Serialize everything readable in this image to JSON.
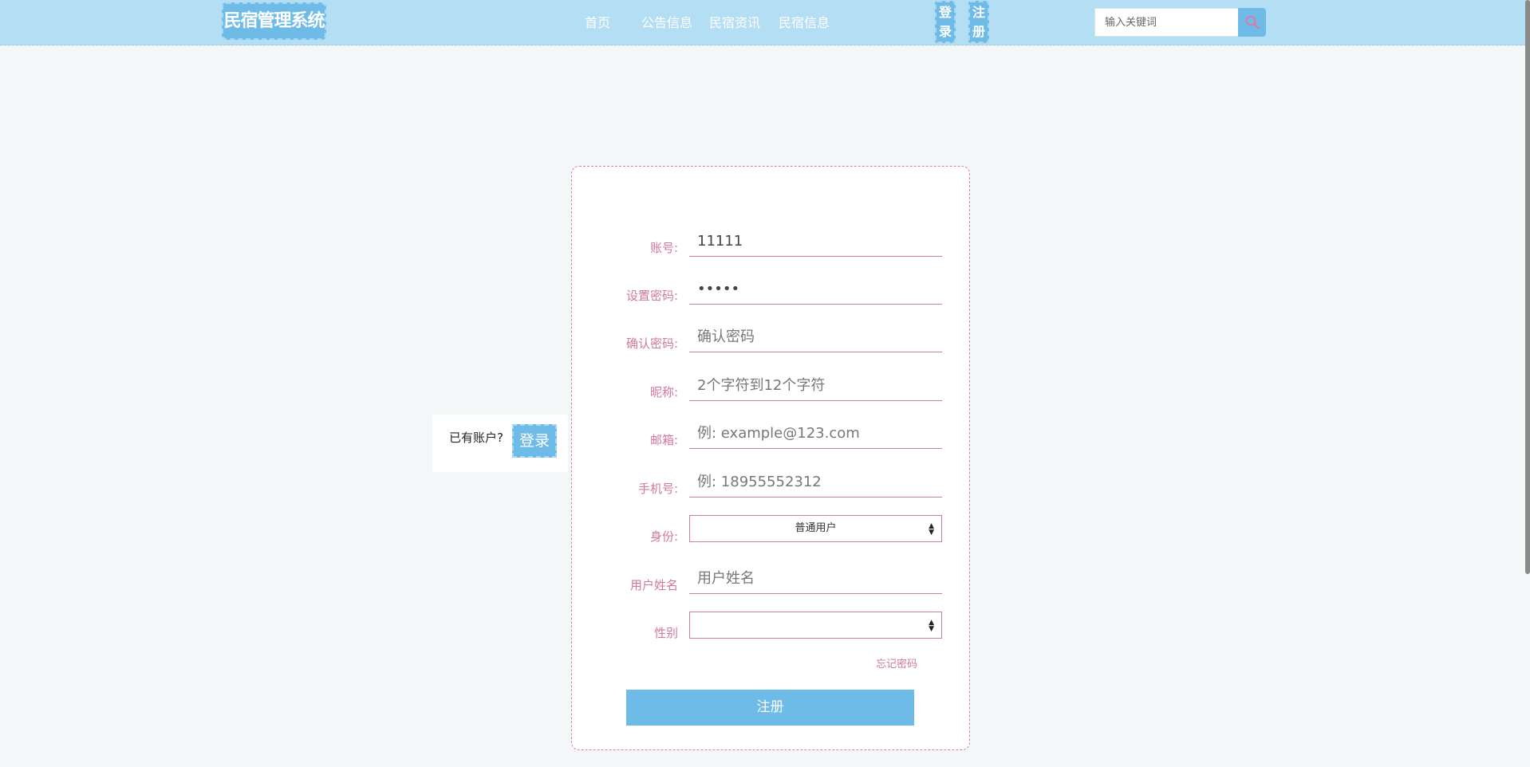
{
  "header": {
    "logo": "民宿管理系统",
    "nav": {
      "home": "首页",
      "notice": "公告信息",
      "news": "民宿资讯",
      "bnb": "民宿信息"
    },
    "login_chars": [
      "登",
      "录"
    ],
    "register_chars": [
      "注",
      "册"
    ],
    "search": {
      "placeholder": "输入关键词",
      "icon": "search-icon"
    }
  },
  "side": {
    "tip": "已有账户?",
    "login_label": "登录"
  },
  "form": {
    "account": {
      "label": "账号:",
      "value": "11111",
      "placeholder": ""
    },
    "password": {
      "label": "设置密码:",
      "value": "•••••",
      "placeholder": ""
    },
    "confirm": {
      "label": "确认密码:",
      "placeholder": "确认密码"
    },
    "nickname": {
      "label": "昵称:",
      "placeholder": "2个字符到12个字符"
    },
    "email": {
      "label": "邮箱:",
      "placeholder": "例: example@123.com"
    },
    "phone": {
      "label": "手机号:",
      "placeholder": "例: 18955552312"
    },
    "role": {
      "label": "身份:",
      "selected": "普通用户"
    },
    "realname": {
      "label": "用户姓名",
      "placeholder": "用户姓名"
    },
    "gender": {
      "label": "性别",
      "selected": ""
    },
    "forgot": "忘记密码",
    "submit": "注册"
  },
  "colors": {
    "header_bg": "#b3def3",
    "accent_blue": "#6fbbe8",
    "label_pink": "#d2779d",
    "page_bg": "#f4f7f8"
  }
}
